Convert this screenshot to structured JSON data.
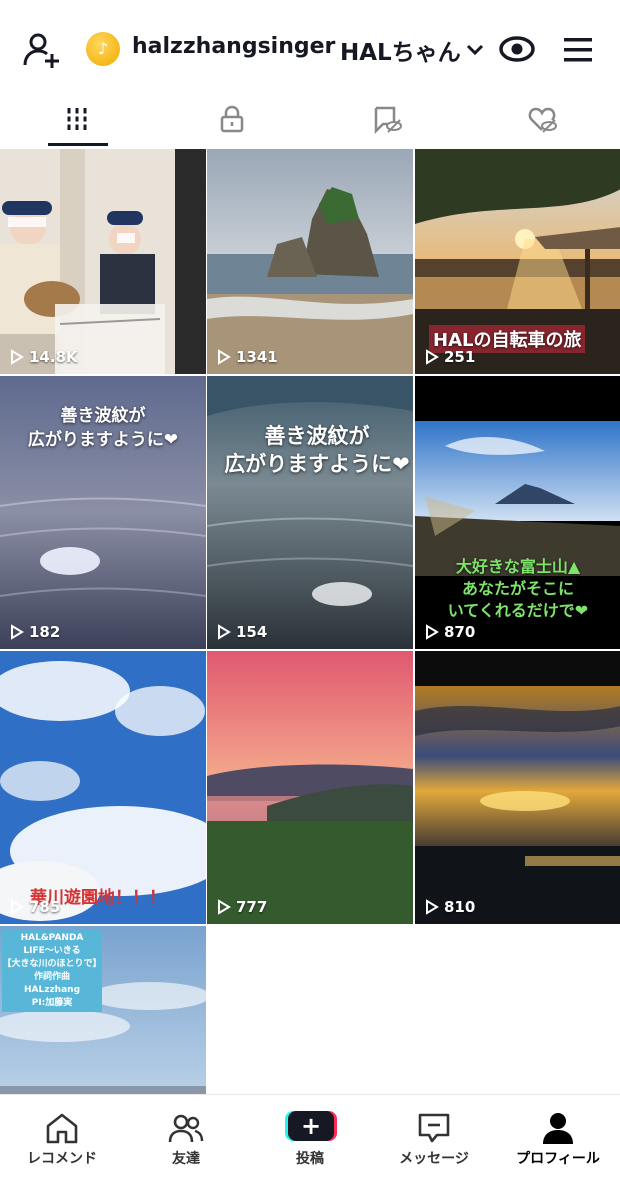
{
  "header": {
    "username": "halzzhangsinger",
    "display_name": "HALちゃん",
    "coin_glyph": "♪",
    "icons": [
      "add-user-icon",
      "coin-icon",
      "chevron-down-icon",
      "eye-icon",
      "menu-icon"
    ]
  },
  "tabs": [
    {
      "name": "videos",
      "icon": "grid-icon",
      "active": true
    },
    {
      "name": "private",
      "icon": "lock-icon",
      "active": false
    },
    {
      "name": "favorites",
      "icon": "bookmark-hidden-icon",
      "active": false
    },
    {
      "name": "liked",
      "icon": "heart-hidden-icon",
      "active": false
    }
  ],
  "videos": [
    {
      "views": "14.8K",
      "caption": ""
    },
    {
      "views": "1341",
      "caption": ""
    },
    {
      "views": "251",
      "caption": "HALの自転車の旅"
    },
    {
      "views": "182",
      "caption_lines": [
        "善き波紋が",
        "広がりますように❤"
      ]
    },
    {
      "views": "154",
      "caption_lines": [
        "善き波紋が",
        "広がりますように❤"
      ]
    },
    {
      "views": "870",
      "caption_lines": [
        "大好きな富士山▲",
        "あなたがそこに",
        "いてくれるだけで❤"
      ]
    },
    {
      "views": "785",
      "caption": "華川遊園地！！！"
    },
    {
      "views": "777",
      "caption": ""
    },
    {
      "views": "810",
      "caption": ""
    },
    {
      "views": "",
      "caption_lines": [
        "HAL&PANDA",
        "LIFE〜いきる",
        "【大きな川のほとりで】",
        "作詞作曲　HALzzhang",
        "PI:加藤実"
      ]
    }
  ],
  "bottom_nav": [
    {
      "label": "レコメンド",
      "icon": "home-icon"
    },
    {
      "label": "友達",
      "icon": "friends-icon"
    },
    {
      "label": "投稿",
      "icon": "plus-icon"
    },
    {
      "label": "メッセージ",
      "icon": "message-icon"
    },
    {
      "label": "プロフィール",
      "icon": "profile-icon",
      "active": true
    }
  ]
}
